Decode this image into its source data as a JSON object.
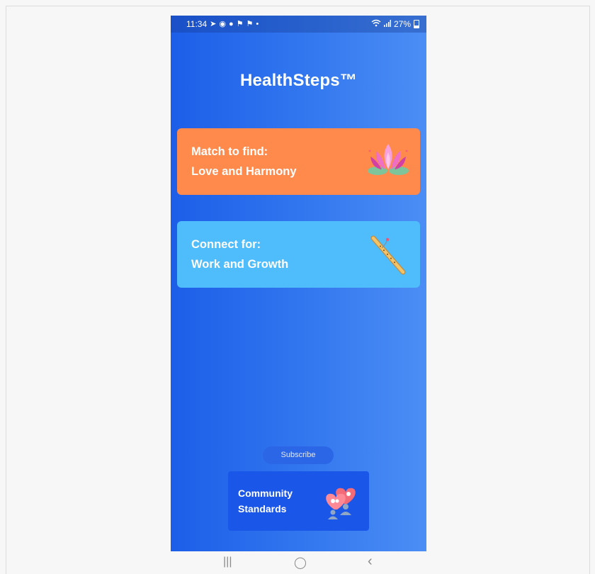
{
  "status_bar": {
    "time": "11:34",
    "battery_percent": "27%",
    "notification_icons": [
      "navigation-arrow-icon",
      "messenger-icon",
      "chat-bubble-icon",
      "pennant-icon",
      "pennant-icon",
      "dot-icon"
    ]
  },
  "app": {
    "title": "HealthSteps™"
  },
  "cards": {
    "love": {
      "line1": "Match to find:",
      "line2": "Love and Harmony",
      "icon": "lotus-icon",
      "color": "#ff8a4c"
    },
    "work": {
      "line1": "Connect for:",
      "line2": "Work and Growth",
      "icon": "flute-icon",
      "color": "#4fbcfc"
    }
  },
  "subscribe": {
    "label": "Subscribe"
  },
  "community": {
    "line1": "Community",
    "line2": "Standards",
    "icon": "hearts-people-icon"
  },
  "nav": {
    "recents": "|||",
    "home": "◯",
    "back": "‹"
  },
  "colors": {
    "gradient_start": "#1d5ee8",
    "gradient_end": "#4b8ef5",
    "community_bg": "#1a56e8"
  }
}
